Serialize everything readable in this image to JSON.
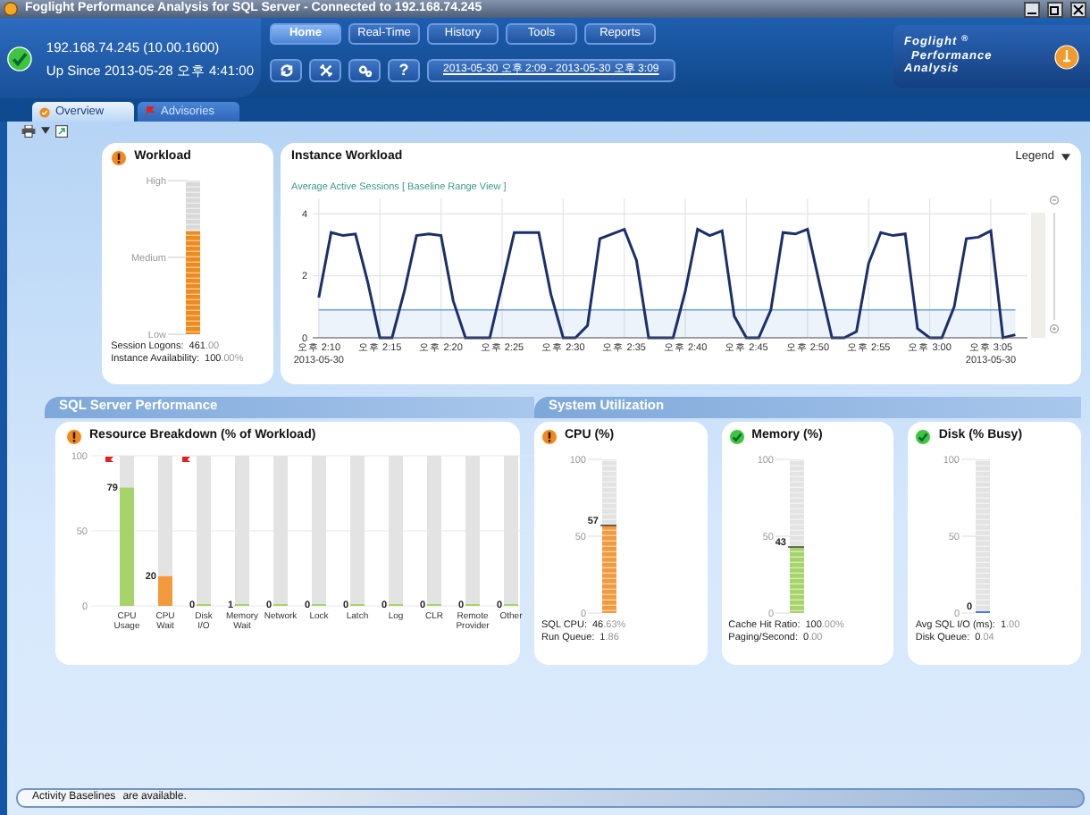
{
  "window": {
    "title": "Foglight Performance Analysis for SQL Server - Connected to 192.168.74.245"
  },
  "header": {
    "alert": false,
    "server": "192.168.74.245 (10.00.1600)",
    "uptime": "Up Since 2013-05-28 오후 4:41:00",
    "nav": [
      {
        "label": "Home",
        "selected": true
      },
      {
        "label": "Real-Time",
        "selected": false
      },
      {
        "label": "History",
        "selected": false
      },
      {
        "label": "Tools",
        "selected": false
      },
      {
        "label": "Reports",
        "selected": false
      }
    ],
    "tools": [
      {
        "kind": "refresh"
      },
      {
        "kind": "tools"
      },
      {
        "kind": "settings"
      },
      {
        "kind": "help",
        "label": "?"
      }
    ],
    "time_range": "2013-05-30 오후 2:09 - 2013-05-30 오후 3:09",
    "logo": {
      "name": "Foglight",
      "mark": "®",
      "line2": "Performance",
      "line3": "Analysis"
    }
  },
  "tabs": [
    {
      "label": "Overview",
      "selected": true
    },
    {
      "label": "Advisories",
      "selected": false
    }
  ],
  "workload": {
    "title": "Workload",
    "alert": true,
    "level": 0.67,
    "scale": [
      "High",
      "Medium",
      "Low"
    ],
    "stats": [
      {
        "label": "Session Logons:",
        "value": "461",
        "fraction": ".00"
      },
      {
        "label": "Instance Availability:",
        "value": "100",
        "fraction": ".00%"
      }
    ]
  },
  "instance_workload": {
    "title": "Instance Workload",
    "legend": "Legend",
    "open": "[",
    "link": "Baseline Range View",
    "close": "]",
    "dates": [
      "2013-05-30",
      "2013-05-30"
    ],
    "chart_data": {
      "type": "line",
      "categories": [
        "오후 2:10",
        null,
        null,
        null,
        null,
        "오후 2:15",
        null,
        null,
        null,
        null,
        "오후 2:20",
        null,
        null,
        null,
        null,
        "오후 2:25",
        null,
        null,
        null,
        null,
        "오후 2:30",
        null,
        null,
        null,
        null,
        "오후 2:35",
        null,
        null,
        null,
        null,
        "오후 2:40",
        null,
        null,
        null,
        null,
        "오후 2:45",
        null,
        null,
        null,
        null,
        "오후 2:50",
        null,
        null,
        null,
        null,
        "오후 2:55",
        null,
        null,
        null,
        null,
        "오후 3:00",
        null,
        null,
        null,
        null,
        "오후 3:05",
        null,
        null
      ],
      "series": [
        {
          "name": "Average Active Sessions",
          "color": "#1b2f6b",
          "values": [
            1.3,
            3.4,
            3.3,
            3.35,
            1.8,
            0,
            0,
            1.5,
            3.3,
            3.35,
            3.3,
            1.2,
            0,
            0,
            0,
            1.7,
            3.4,
            3.4,
            3.4,
            1.4,
            0,
            0,
            0.4,
            3.2,
            3.35,
            3.5,
            2.5,
            0,
            0,
            0,
            1.5,
            3.5,
            3.3,
            3.45,
            0.7,
            0,
            0,
            0.9,
            3.4,
            3.35,
            3.5,
            1.7,
            0,
            0,
            0.2,
            2.4,
            3.4,
            3.3,
            3.35,
            0.3,
            0,
            0,
            1.0,
            3.2,
            3.25,
            3.45,
            0,
            0.1
          ]
        },
        {
          "type": "area",
          "color": "#6f9ee0",
          "values": [
            0.9,
            0.9,
            0.9,
            0.9,
            0.9,
            0.9,
            0.9,
            0.9,
            0.9,
            0.9,
            0.9,
            0.9,
            0.9,
            0.9,
            0.9,
            0.9,
            0.9,
            0.9,
            0.9,
            0.9,
            0.9,
            0.9,
            0.9,
            0.9,
            0.9,
            0.9,
            0.9,
            0.9,
            0.9,
            0.9,
            0.9,
            0.9,
            0.9,
            0.9,
            0.9,
            0.9,
            0.9,
            0.9,
            0.9,
            0.9,
            0.9,
            0.9,
            0.9,
            0.9,
            0.9,
            0.9,
            0.9,
            0.9,
            0.9,
            0.9,
            0.9,
            0.9,
            0.9,
            0.9,
            0.9,
            0.9,
            0.9,
            0.9
          ]
        }
      ],
      "ylim": [
        0,
        4.5
      ],
      "yticks": [
        0,
        2,
        4
      ],
      "grid": true
    }
  },
  "sql_server_performance": {
    "section": "SQL Server Performance",
    "title": "Resource Breakdown (% of Workload)",
    "alert": true,
    "flagged": [
      true,
      false,
      true,
      false,
      false,
      false,
      false,
      false,
      false,
      false,
      false
    ],
    "chart_data": {
      "type": "bar",
      "categories": [
        "CPU Usage",
        "CPU Wait",
        "Disk I/O",
        "Memory Wait",
        "Network",
        "Lock",
        "Latch",
        "Log",
        "CLR",
        "Remote Provider",
        "Other"
      ],
      "series": [
        {
          "values": [
            79,
            20,
            0,
            1,
            0,
            0,
            0,
            0,
            0,
            0,
            0
          ],
          "colors": [
            "#a6d46a",
            "#f39a3c",
            "#a6d46a",
            "#a6d46a",
            "#a6d46a",
            "#a6d46a",
            "#a6d46a",
            "#a6d46a",
            "#a6d46a",
            "#a6d46a",
            "#a6d46a"
          ]
        },
        {
          "color": "#e3e3e3",
          "values": [
            21,
            80,
            100,
            99,
            100,
            100,
            100,
            100,
            100,
            100,
            100
          ]
        }
      ],
      "stacked": true,
      "ylim": [
        0,
        100
      ],
      "yticks": [
        0,
        50,
        100
      ],
      "grid": true,
      "value_labels": [
        "79",
        "20",
        "0",
        "1",
        "0",
        "0",
        "0",
        "0",
        "0",
        "0",
        "0"
      ]
    }
  },
  "system_utilization": {
    "section": "System Utilization",
    "gauges": [
      {
        "title": "CPU (%)",
        "alert": true,
        "level": 0.57,
        "reading": "57",
        "color": "#f39a3c",
        "ticks": [
          "100",
          "50",
          "0"
        ],
        "stats": [
          {
            "label": "SQL CPU:",
            "value": "46",
            "fraction": ".63%"
          },
          {
            "label": "Run Queue:",
            "value": "1",
            "fraction": ".86"
          }
        ]
      },
      {
        "title": "Memory (%)",
        "alert": false,
        "level": 0.43,
        "reading": "43",
        "color": "#a6d46a",
        "ticks": [
          "100",
          "50",
          "0"
        ],
        "stats": [
          {
            "label": "Cache Hit Ratio:",
            "value": "100",
            "fraction": ".00%"
          },
          {
            "label": "Paging/Second:",
            "value": "0",
            "fraction": ".00"
          }
        ]
      },
      {
        "title": "Disk (% Busy)",
        "alert": false,
        "level": 0,
        "reading": "0",
        "color": "#4a7fd4",
        "ticks": [
          "100",
          "50",
          "0"
        ],
        "stats": [
          {
            "label": "Avg SQL I/O (ms):",
            "value": "1",
            "fraction": ".00"
          },
          {
            "label": "Disk Queue:",
            "value": "0",
            "fraction": ".04"
          }
        ]
      }
    ]
  },
  "status_bar": {
    "link": "Activity Baselines",
    "text": "are available."
  }
}
